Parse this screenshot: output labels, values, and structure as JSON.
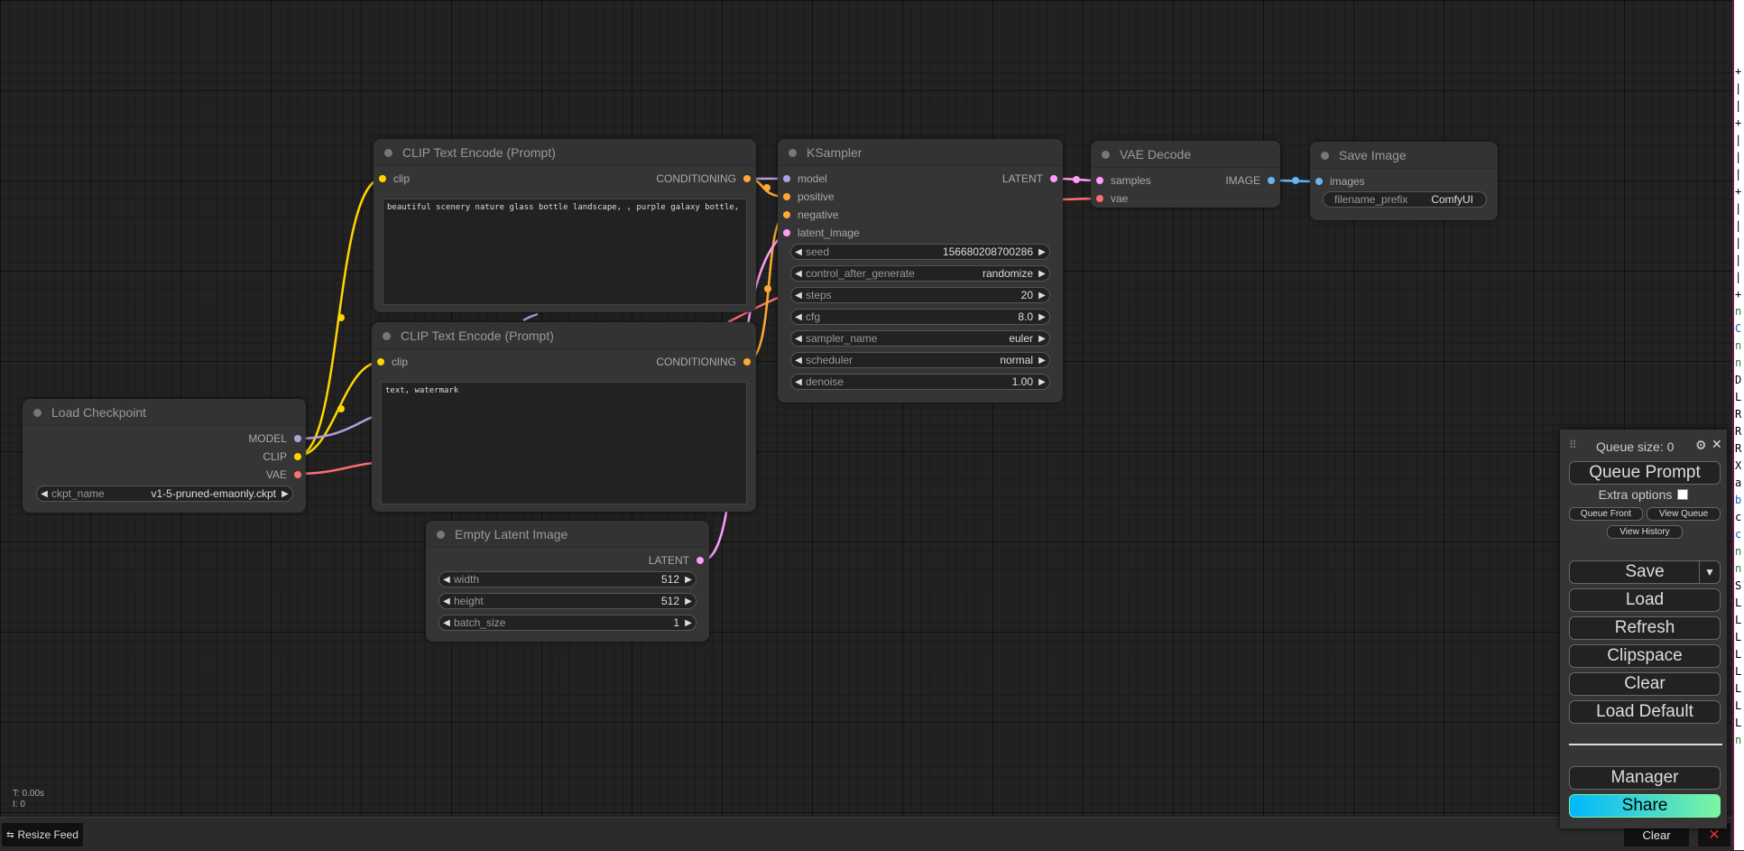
{
  "nodes": {
    "clip_pos": {
      "title": "CLIP Text Encode (Prompt)",
      "input": "clip",
      "output": "CONDITIONING",
      "text": "beautiful scenery nature glass bottle landscape, , purple galaxy bottle,"
    },
    "clip_neg": {
      "title": "CLIP Text Encode (Prompt)",
      "input": "clip",
      "output": "CONDITIONING",
      "text": "text, watermark"
    },
    "ksampler": {
      "title": "KSampler",
      "inputs": [
        "model",
        "positive",
        "negative",
        "latent_image"
      ],
      "output": "LATENT",
      "widgets": [
        {
          "label": "seed",
          "value": "156680208700286"
        },
        {
          "label": "control_after_generate",
          "value": "randomize"
        },
        {
          "label": "steps",
          "value": "20"
        },
        {
          "label": "cfg",
          "value": "8.0"
        },
        {
          "label": "sampler_name",
          "value": "euler"
        },
        {
          "label": "scheduler",
          "value": "normal"
        },
        {
          "label": "denoise",
          "value": "1.00"
        }
      ]
    },
    "vae_decode": {
      "title": "VAE Decode",
      "inputs": [
        "samples",
        "vae"
      ],
      "output": "IMAGE"
    },
    "save_image": {
      "title": "Save Image",
      "input": "images",
      "widget": {
        "label": "filename_prefix",
        "value": "ComfyUI"
      }
    },
    "load_checkpoint": {
      "title": "Load Checkpoint",
      "outputs": [
        "MODEL",
        "CLIP",
        "VAE"
      ],
      "widget": {
        "label": "ckpt_name",
        "value": "v1-5-pruned-emaonly.ckpt"
      }
    },
    "empty_latent": {
      "title": "Empty Latent Image",
      "output": "LATENT",
      "widgets": [
        {
          "label": "width",
          "value": "512"
        },
        {
          "label": "height",
          "value": "512"
        },
        {
          "label": "batch_size",
          "value": "1"
        }
      ]
    }
  },
  "menu": {
    "queue_size": "Queue size: 0",
    "queue_prompt": "Queue Prompt",
    "extra_options": "Extra options",
    "queue_front": "Queue Front",
    "view_queue": "View Queue",
    "view_history": "View History",
    "save": "Save",
    "load": "Load",
    "refresh": "Refresh",
    "clipspace": "Clipspace",
    "clear": "Clear",
    "load_default": "Load Default",
    "manager": "Manager",
    "share": "Share"
  },
  "stats": {
    "time": "T: 0.00s",
    "i": "I: 0"
  },
  "bottom": {
    "resize_feed": "Resize Feed",
    "clear": "Clear"
  },
  "colors": {
    "clip": "#ffd500",
    "model": "#b39ddb",
    "vae": "#ff6e6e",
    "latent": "#ff9cf9",
    "conditioning": "#ffa931",
    "image": "#64b5f6"
  }
}
